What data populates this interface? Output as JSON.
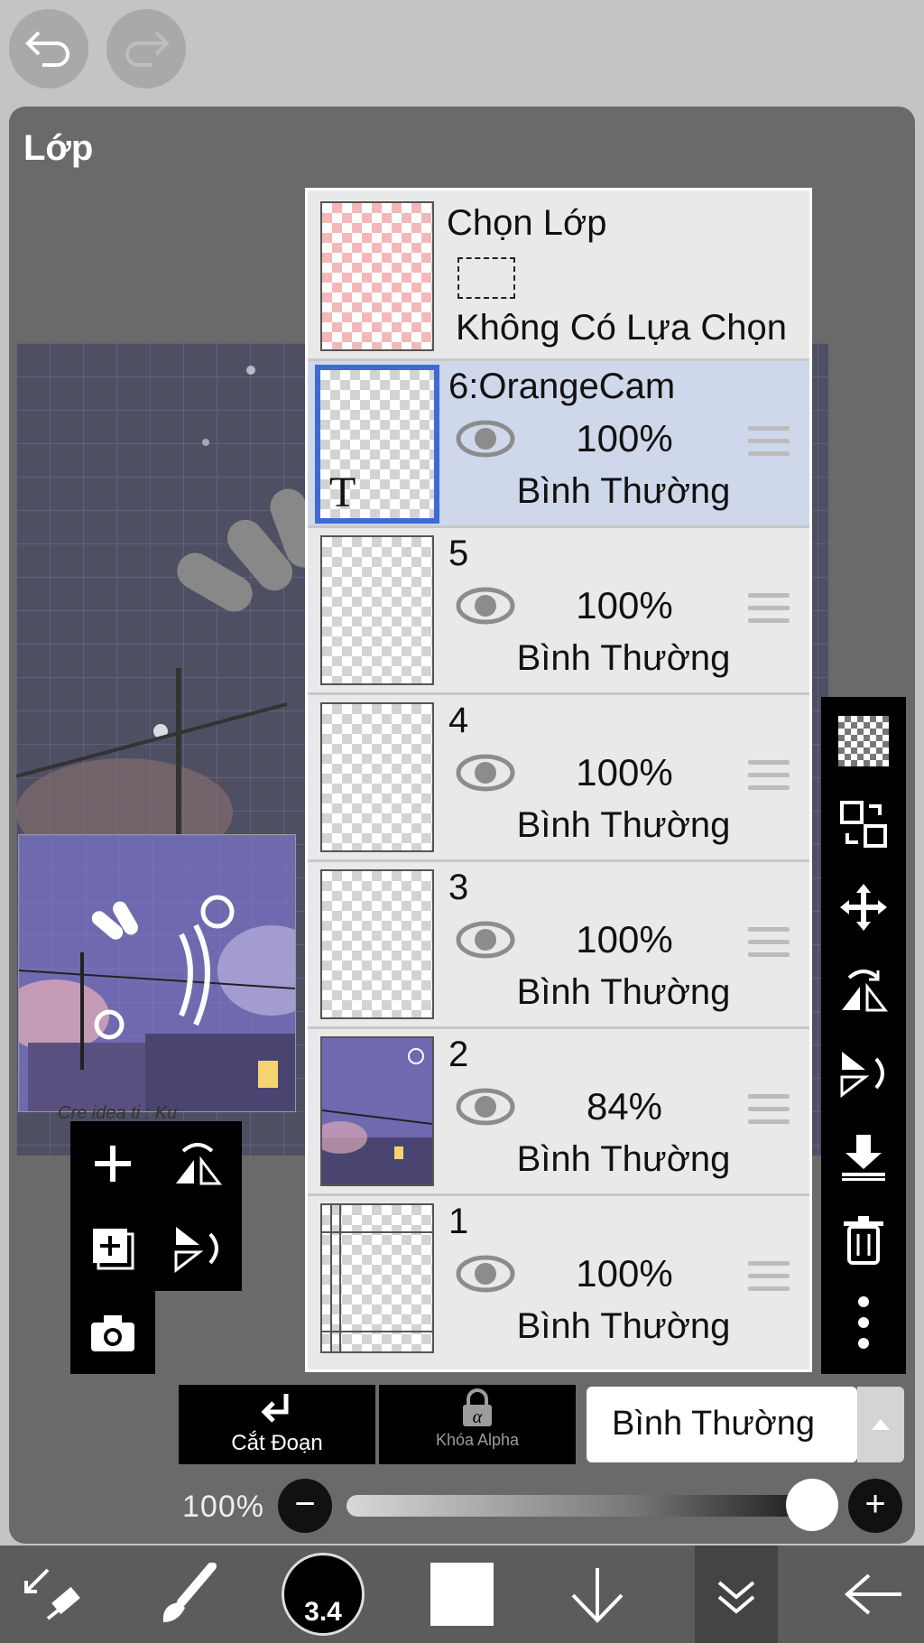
{
  "panel": {
    "title": "Lớp"
  },
  "selection": {
    "title": "Chọn Lớp",
    "status": "Không Có Lựa Chọn"
  },
  "layers": [
    {
      "name": "6:OrangeCam",
      "opacity": "100%",
      "blend": "Bình Thường",
      "active": true
    },
    {
      "name": "5",
      "opacity": "100%",
      "blend": "Bình Thường",
      "active": false
    },
    {
      "name": "4",
      "opacity": "100%",
      "blend": "Bình Thường",
      "active": false
    },
    {
      "name": "3",
      "opacity": "100%",
      "blend": "Bình Thường",
      "active": false
    },
    {
      "name": "2",
      "opacity": "84%",
      "blend": "Bình Thường",
      "active": false
    },
    {
      "name": "1",
      "opacity": "100%",
      "blend": "Bình Thường",
      "active": false
    }
  ],
  "bottom_controls": {
    "clip_label": "Cắt Đoạn",
    "alpha_lock_label": "Khóa Alpha",
    "blend_mode": "Bình Thường",
    "opacity_label": "100%",
    "opacity_value": 1.0
  },
  "toolbar": {
    "brush_size": "3.4"
  },
  "thumbnail_caption": "Cre idea ti : Ku",
  "icons": {
    "undo": "undo-icon",
    "redo": "redo-icon",
    "right_bar": [
      "checker-icon",
      "transfer-icon",
      "move-icon",
      "flip-horizontal-icon",
      "flip-vertical-icon",
      "merge-down-icon",
      "trash-icon",
      "more-icon"
    ],
    "left_tools": [
      "add-layer-icon",
      "flip-layer-icon",
      "duplicate-icon",
      "rotate-layer-icon",
      "camera-icon"
    ]
  },
  "colors": {
    "active_layer": "#cfd7ea",
    "active_border": "#3d6bd1",
    "panel_bg": "#6a6a6a",
    "selection_thumb": "#f4b8b8"
  }
}
